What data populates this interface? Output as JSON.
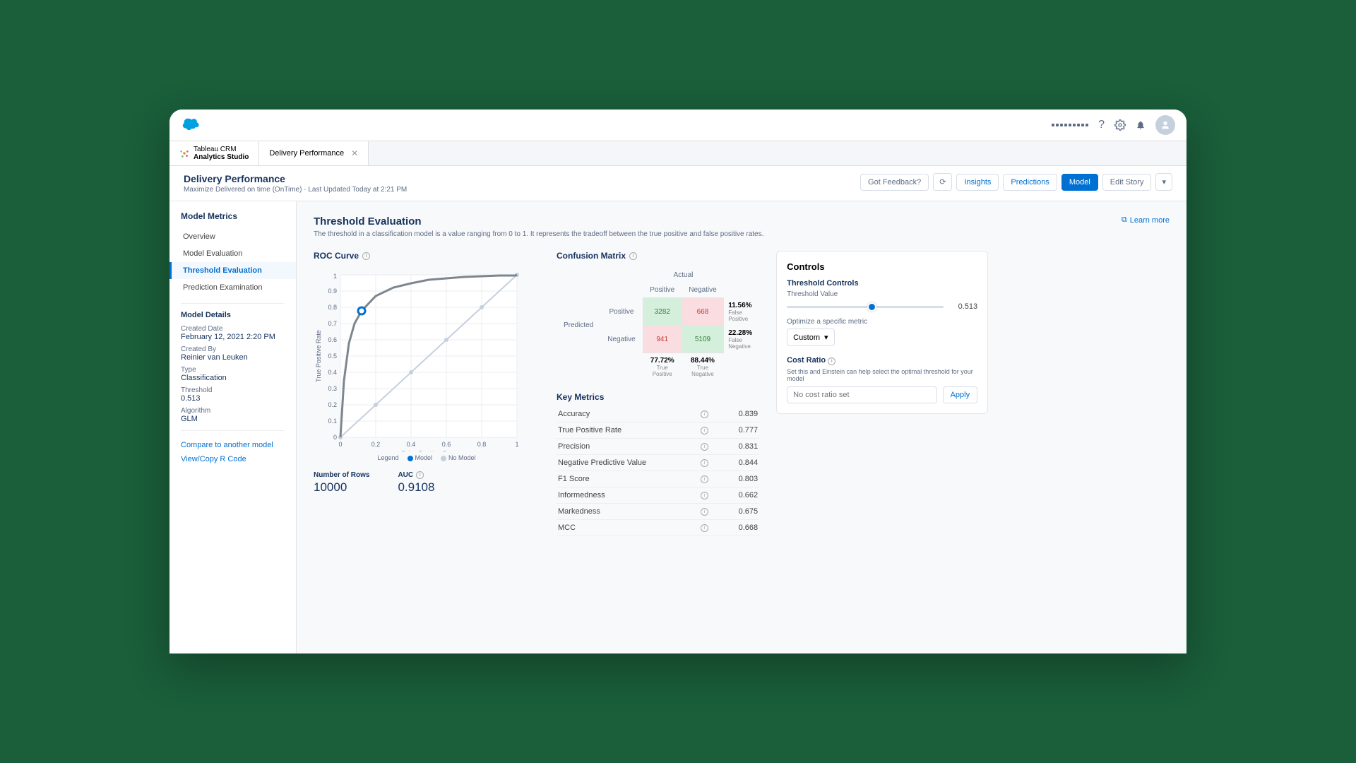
{
  "tabs": {
    "app_line1": "Tableau CRM",
    "app_line2": "Analytics Studio",
    "page": "Delivery Performance"
  },
  "header": {
    "title": "Delivery Performance",
    "subtitle": "Maximize Delivered on time (OnTime) · Last Updated Today at 2:21 PM",
    "feedback": "Got Feedback?",
    "insights": "Insights",
    "predictions": "Predictions",
    "model": "Model",
    "edit": "Edit Story"
  },
  "sidebar": {
    "title": "Model Metrics",
    "items": [
      "Overview",
      "Model Evaluation",
      "Threshold Evaluation",
      "Prediction Examination"
    ],
    "details_title": "Model Details",
    "created_date_label": "Created Date",
    "created_date": "February 12, 2021 2:20 PM",
    "created_by_label": "Created By",
    "created_by": "Reinier van Leuken",
    "type_label": "Type",
    "type": "Classification",
    "threshold_label": "Threshold",
    "threshold": "0.513",
    "algorithm_label": "Algorithm",
    "algorithm": "GLM",
    "compare": "Compare to another model",
    "viewcode": "View/Copy R Code"
  },
  "main": {
    "title": "Threshold Evaluation",
    "learn": "Learn more",
    "desc": "The threshold in a classification model is a value ranging from 0 to 1. It represents the tradeoff between the true positive and false positive rates."
  },
  "roc": {
    "title": "ROC Curve",
    "xlabel": "False Positive Rate",
    "ylabel": "True Positive Rate",
    "legend_label": "Legend",
    "legend_model": "Model",
    "legend_nomodel": "No Model",
    "rows_label": "Number of Rows",
    "rows": "10000",
    "auc_label": "AUC",
    "auc": "0.9108"
  },
  "confusion": {
    "title": "Confusion Matrix",
    "actual": "Actual",
    "predicted": "Predicted",
    "positive": "Positive",
    "negative": "Negative",
    "tp": "3282",
    "fp": "668",
    "fn": "941",
    "tn": "5109",
    "fp_pct": "11.56%",
    "fp_pct_label": "False Positive",
    "fn_pct": "22.28%",
    "fn_pct_label": "False Negative",
    "col1_pct": "77.72%",
    "col1_label": "True Positive",
    "col2_pct": "88.44%",
    "col2_label": "True Negative"
  },
  "metrics": {
    "title": "Key Metrics",
    "rows": [
      {
        "label": "Accuracy",
        "val": "0.839"
      },
      {
        "label": "True Positive Rate",
        "val": "0.777"
      },
      {
        "label": "Precision",
        "val": "0.831"
      },
      {
        "label": "Negative Predictive Value",
        "val": "0.844"
      },
      {
        "label": "F1 Score",
        "val": "0.803"
      },
      {
        "label": "Informedness",
        "val": "0.662"
      },
      {
        "label": "Markedness",
        "val": "0.675"
      },
      {
        "label": "MCC",
        "val": "0.668"
      }
    ]
  },
  "controls": {
    "title": "Controls",
    "threshold_controls": "Threshold Controls",
    "threshold_value_label": "Threshold Value",
    "threshold_value": "0.513",
    "optimize_label": "Optimize a specific metric",
    "optimize_select": "Custom",
    "cost_ratio_label": "Cost Ratio",
    "cost_hint": "Set this and Einstein can help select the optimal threshold for your model",
    "cost_placeholder": "No cost ratio set",
    "apply": "Apply"
  },
  "chart_data": {
    "type": "line",
    "title": "ROC Curve",
    "xlabel": "False Positive Rate",
    "ylabel": "True Positive Rate",
    "xlim": [
      0,
      1
    ],
    "ylim": [
      0,
      1
    ],
    "threshold_point": {
      "x": 0.12,
      "y": 0.78
    },
    "series": [
      {
        "name": "Model",
        "x": [
          0,
          0.02,
          0.05,
          0.08,
          0.12,
          0.2,
          0.3,
          0.4,
          0.5,
          0.6,
          0.7,
          0.8,
          0.9,
          1
        ],
        "y": [
          0,
          0.35,
          0.58,
          0.7,
          0.78,
          0.87,
          0.92,
          0.95,
          0.97,
          0.98,
          0.99,
          0.995,
          0.998,
          1
        ]
      },
      {
        "name": "No Model",
        "x": [
          0,
          1
        ],
        "y": [
          0,
          1
        ]
      }
    ]
  }
}
